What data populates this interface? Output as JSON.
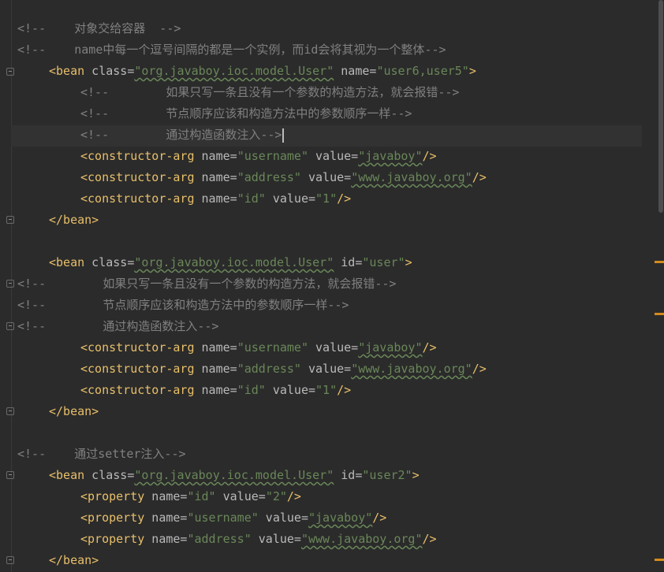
{
  "colors": {
    "comment": "#808080",
    "tag": "#e8bf6a",
    "attr": "#bababa",
    "value": "#6a8759",
    "bg": "#2b2b2b",
    "marker": "#d68b1a"
  },
  "lines": {
    "l1": {
      "c": "<!--    对象交给容器  -->"
    },
    "l2": {
      "c": "<!--    name中每一个逗号间隔的都是一个实例，而id会将其视为一个整体-->"
    },
    "l3": {
      "tag": "<bean",
      "a1": " class=",
      "v1": "\"org.javaboy.ioc.model.User\"",
      "a2": " name=",
      "v2": "\"user6,user5\"",
      "end": ">"
    },
    "l4": {
      "c": "<!--        如果只写一条且没有一个参数的构造方法，就会报错-->"
    },
    "l5": {
      "c": "<!--        节点顺序应该和构造方法中的参数顺序一样-->"
    },
    "l6": {
      "c": "<!--        通过构造函数注入-->"
    },
    "l7": {
      "tag": "<constructor-arg",
      "a1": " name=",
      "v1": "\"username\"",
      "a2": " value=",
      "v2": "\"javaboy\"",
      "end": "/>"
    },
    "l8": {
      "tag": "<constructor-arg",
      "a1": " name=",
      "v1": "\"address\"",
      "a2": " value=",
      "v2": "\"www.javaboy.org\"",
      "end": "/>"
    },
    "l9": {
      "tag": "<constructor-arg",
      "a1": " name=",
      "v1": "\"id\"",
      "a2": " value=",
      "v2": "\"1\"",
      "end": "/>"
    },
    "l10": {
      "tag": "</bean>"
    },
    "l11": {
      "tag": "<bean",
      "a1": " class=",
      "v1": "\"org.javaboy.ioc.model.User\"",
      "a2": " id=",
      "v2": "\"user\"",
      "end": ">"
    },
    "l12": {
      "c": "<!--        如果只写一条且没有一个参数的构造方法，就会报错-->"
    },
    "l13": {
      "c": "<!--        节点顺序应该和构造方法中的参数顺序一样-->"
    },
    "l14": {
      "c": "<!--        通过构造函数注入-->"
    },
    "l15": {
      "tag": "<constructor-arg",
      "a1": " name=",
      "v1": "\"username\"",
      "a2": " value=",
      "v2": "\"javaboy\"",
      "end": "/>"
    },
    "l16": {
      "tag": "<constructor-arg",
      "a1": " name=",
      "v1": "\"address\"",
      "a2": " value=",
      "v2": "\"www.javaboy.org\"",
      "end": "/>"
    },
    "l17": {
      "tag": "<constructor-arg",
      "a1": " name=",
      "v1": "\"id\"",
      "a2": " value=",
      "v2": "\"1\"",
      "end": "/>"
    },
    "l18": {
      "tag": "</bean>"
    },
    "l19": {
      "c": "<!--    通过setter注入-->"
    },
    "l20": {
      "tag": "<bean",
      "a1": " class=",
      "v1": "\"org.javaboy.ioc.model.User\"",
      "a2": " id=",
      "v2": "\"user2\"",
      "end": ">"
    },
    "l21": {
      "tag": "<property",
      "a1": " name=",
      "v1": "\"id\"",
      "a2": " value=",
      "v2": "\"2\"",
      "end": "/>"
    },
    "l22": {
      "tag": "<property",
      "a1": " name=",
      "v1": "\"username\"",
      "a2": " value=",
      "v2": "\"javaboy\"",
      "end": "/>"
    },
    "l23": {
      "tag": "<property",
      "a1": " name=",
      "v1": "\"address\"",
      "a2": " value=",
      "v2": "\"www.javaboy.org\"",
      "end": "/>"
    },
    "l24": {
      "tag": "</bean>"
    }
  }
}
